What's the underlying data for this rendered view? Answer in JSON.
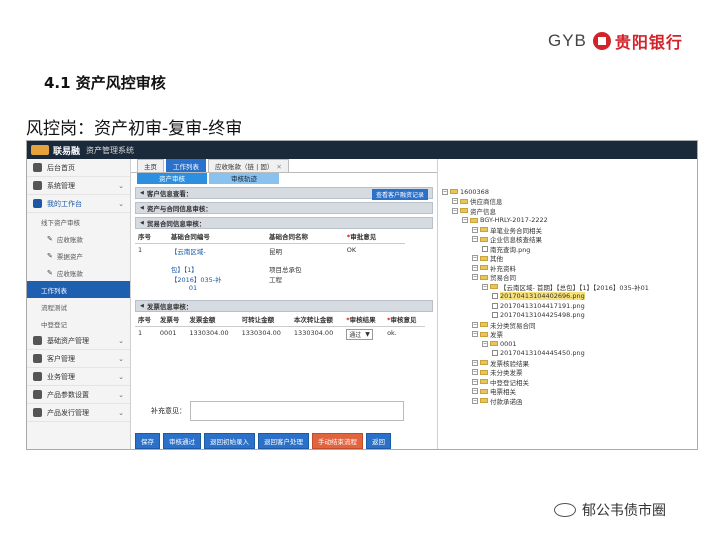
{
  "logo": {
    "text": "GYB",
    "bank_name": "贵阳银行"
  },
  "slide": {
    "title": "4.1 资产风控审核",
    "subtitle": "风控岗：资产初审-复审-终审"
  },
  "app": {
    "brand": "联易融",
    "system": "资产管理系统"
  },
  "sidebar": {
    "items": [
      {
        "label": "后台首页"
      },
      {
        "label": "系统管理"
      },
      {
        "label": "我的工作台"
      },
      {
        "label": "线下资产审核"
      },
      {
        "label": "应收账款"
      },
      {
        "label": "票据资产"
      },
      {
        "label": "应收账款"
      },
      {
        "label": "工作列表"
      },
      {
        "label": "流程测试"
      },
      {
        "label": "中登登记"
      },
      {
        "label": "基础资产管理"
      },
      {
        "label": "客户管理"
      },
      {
        "label": "业务管理"
      },
      {
        "label": "产品参数设置"
      },
      {
        "label": "产品发行管理"
      }
    ]
  },
  "tabs": {
    "home": "主页",
    "worklist": "工作列表",
    "receivable": "应收账款（链 | 固）",
    "close": "✕"
  },
  "subtabs": {
    "review": "资产审核",
    "track": "审核轨迹"
  },
  "sections": {
    "customer": "客户信息查看：",
    "contract": "资产与合同信息审核：",
    "trade": "贸易合同信息审核：",
    "invoice": "发票信息审核："
  },
  "history_button": "查看客户融资记录",
  "contract_table": {
    "headers": [
      "序号",
      "基础合同编号",
      "基础合同名称",
      "审批意见"
    ],
    "row": {
      "no": "1",
      "code_lines": [
        "【云南区域-",
        "",
        "包】【1】",
        "【2016】035-补",
        "01"
      ],
      "name_lines": [
        "昆明",
        "",
        "项目总承包",
        "工程"
      ],
      "opinion": "OK"
    }
  },
  "invoice_table": {
    "headers": [
      "序号",
      "发票号",
      "发票金额",
      "可转让金额",
      "本次转让金额",
      "审核结果",
      "审核意见"
    ],
    "row": {
      "no": "1",
      "invoice_no": "0001",
      "amount": "1330304.00",
      "transferable": "1330304.00",
      "this_transfer": "1330304.00",
      "result": "通过",
      "opinion": "ok."
    }
  },
  "supplement": {
    "label": "补充意见："
  },
  "actions": [
    "保存",
    "审核通过",
    "退回初始录入",
    "退回客户处理",
    "手动结束流程",
    "返回"
  ],
  "tree": {
    "nodes": [
      {
        "level": 0,
        "type": "folder",
        "text": "1600368"
      },
      {
        "level": 1,
        "type": "folder",
        "text": "供应商信息"
      },
      {
        "level": 1,
        "type": "folder",
        "text": "资产信息"
      },
      {
        "level": 2,
        "type": "folder",
        "text": "BGY-HRLY-2017-2222"
      },
      {
        "level": 3,
        "type": "folder",
        "text": "单笔业务合同相关"
      },
      {
        "level": 3,
        "type": "folder",
        "text": "企业信息核查结果"
      },
      {
        "level": 4,
        "type": "file",
        "text": "南充查询.png"
      },
      {
        "level": 3,
        "type": "folder",
        "text": "其他"
      },
      {
        "level": 3,
        "type": "folder",
        "text": "补充资料"
      },
      {
        "level": 3,
        "type": "folder",
        "text": "贸易合同"
      },
      {
        "level": 4,
        "type": "folder",
        "text": "【云南区域-          首期】【总包】【1】【2016】035-补01"
      },
      {
        "level": 5,
        "type": "file",
        "text": "20170413104402696.png",
        "highlight": true
      },
      {
        "level": 5,
        "type": "file",
        "text": "20170413104417191.png"
      },
      {
        "level": 5,
        "type": "file",
        "text": "20170413104425498.png"
      },
      {
        "level": 3,
        "type": "folder",
        "text": "未分类贸易合同"
      },
      {
        "level": 3,
        "type": "folder",
        "text": "发票"
      },
      {
        "level": 4,
        "type": "folder",
        "text": "0001"
      },
      {
        "level": 5,
        "type": "file",
        "text": "20170413104445450.png"
      },
      {
        "level": 3,
        "type": "folder",
        "text": "发票核验结果"
      },
      {
        "level": 3,
        "type": "folder",
        "text": "未分类发票"
      },
      {
        "level": 3,
        "type": "folder",
        "text": "中登登记相关"
      },
      {
        "level": 3,
        "type": "folder",
        "text": "电票相关"
      },
      {
        "level": 3,
        "type": "folder",
        "text": "付款承诺函"
      }
    ]
  },
  "watermark": "郁公韦债市圈",
  "colors": {
    "brand_red": "#d2232a",
    "primary_blue": "#2b70c9",
    "danger_orange": "#e2643f",
    "topbar": "#1b2a3a"
  }
}
